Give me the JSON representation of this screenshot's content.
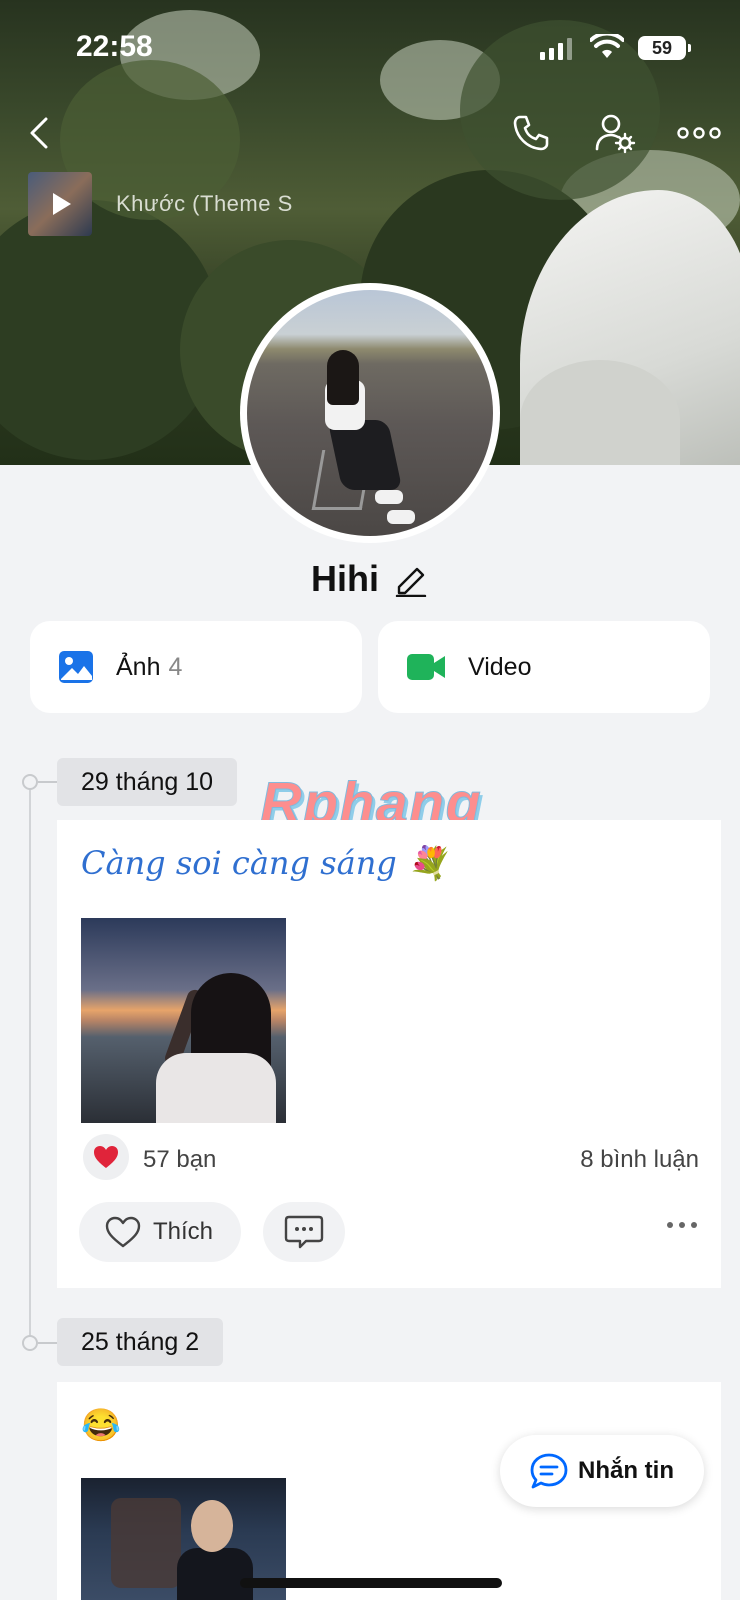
{
  "status_bar": {
    "time": "22:58",
    "battery": "59"
  },
  "header": {
    "icons": [
      "back-icon",
      "phone-icon",
      "user-settings-icon",
      "more-icon"
    ]
  },
  "music": {
    "title": "Khước (Theme S"
  },
  "profile": {
    "name": "Hihi"
  },
  "media": {
    "photos_label": "Ảnh",
    "photos_count": "4",
    "video_label": "Video"
  },
  "watermark": "Rphang",
  "posts": [
    {
      "date": "29 tháng 10",
      "text": "Càng soi càng sáng 💐",
      "reaction_count": "57 bạn",
      "comment_count": "8 bình luận",
      "like_label": "Thích"
    },
    {
      "date": "25 tháng 2",
      "text": "😂"
    }
  ],
  "fab": {
    "label": "Nhắn tin"
  },
  "colors": {
    "accent": "#0068ff",
    "video_green": "#1fb35a",
    "heart": "#e0243a"
  }
}
